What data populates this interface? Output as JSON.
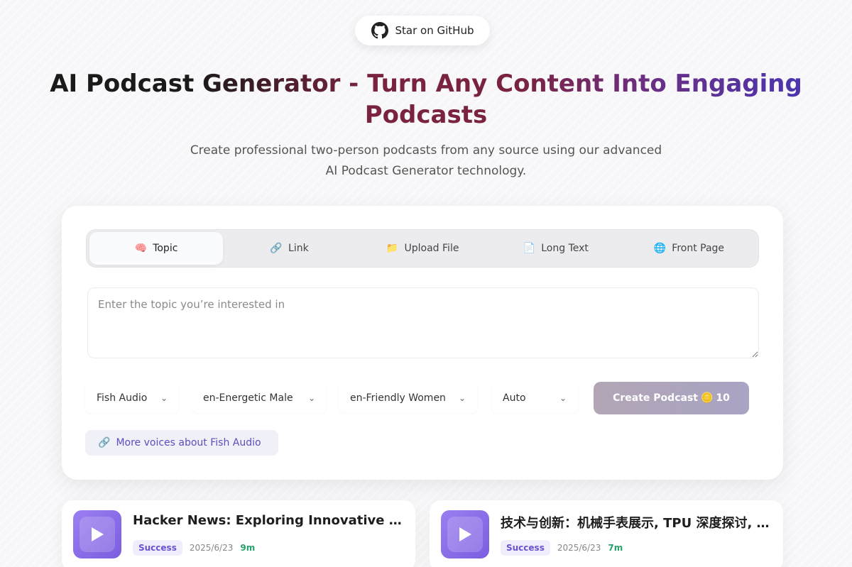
{
  "github": {
    "label": "Star on GitHub",
    "icon": "github-icon"
  },
  "hero": {
    "title": "AI Podcast Generator - Turn Any Content Into Engaging Podcasts",
    "subtitle": "Create professional two-person podcasts from any source using our advanced AI Podcast Generator technology."
  },
  "tabs": [
    {
      "icon": "🧠",
      "label": "Topic",
      "active": true
    },
    {
      "icon": "🔗",
      "label": "Link"
    },
    {
      "icon": "📁",
      "label": "Upload File"
    },
    {
      "icon": "📄",
      "label": "Long Text"
    },
    {
      "icon": "🌐",
      "label": "Front Page"
    }
  ],
  "input": {
    "placeholder": "Enter the topic you’re interested in",
    "value": ""
  },
  "selects": {
    "provider": "Fish Audio",
    "voice1": "en-Energetic Male",
    "voice2": "en-Friendly Women",
    "language": "Auto"
  },
  "create": {
    "label": "Create Podcast",
    "coin_icon": "🪙",
    "cost": "10"
  },
  "more_voices": {
    "label": "More voices about Fish Audio",
    "icon": "🔗"
  },
  "episodes": [
    {
      "title": "Hacker News: Exploring Innovative Projects",
      "status": "Success",
      "date": "2025/6/23",
      "duration": "9m"
    },
    {
      "title": "技术与创新：机械手表展示, TPU 深度探讨, …",
      "status": "Success",
      "date": "2025/6/23",
      "duration": "7m"
    }
  ],
  "colors": {
    "accent": "#6b52d1",
    "success": "#27a36a",
    "thumb": "#8b6ee8"
  }
}
